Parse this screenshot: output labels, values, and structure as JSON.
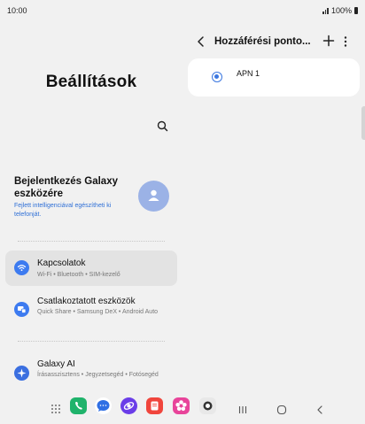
{
  "status_bar": {
    "time": "10:00",
    "battery": "100%"
  },
  "left_pane": {
    "title": "Beállítások",
    "account": {
      "title": "Bejelentkezés Galaxy eszközére",
      "subtitle": "Fejlett intelligenciával egészítheti ki telefonját."
    },
    "items": [
      {
        "title": "Kapcsolatok",
        "subtitle": "Wi-Fi  •  Bluetooth  •  SIM-kezelő",
        "icon": "wifi-icon",
        "color": "#3d7bf0"
      },
      {
        "title": "Csatlakoztatott eszközök",
        "subtitle": "Quick Share  •  Samsung DeX  •  Android Auto",
        "icon": "connected-devices-icon",
        "color": "#3d7bf0"
      },
      {
        "title": "Galaxy AI",
        "subtitle": "Írásasszisztens  •  Jegyzetsegéd  •  Fotósegéd",
        "icon": "galaxy-ai-icon",
        "color": "#3b6fe0"
      }
    ]
  },
  "right_pane": {
    "title": "Hozzáférési ponto...",
    "apn_items": [
      {
        "label": "APN 1",
        "selected": true
      }
    ]
  },
  "dock": {
    "apps": [
      {
        "name": "phone-app",
        "color": "#1fb36b"
      },
      {
        "name": "messages-app",
        "color": "#2f6fe4"
      },
      {
        "name": "internet-app",
        "color": "#6a3de8"
      },
      {
        "name": "notes-app",
        "color": "#f0453c"
      },
      {
        "name": "gallery-app",
        "color": "#e8449a"
      },
      {
        "name": "camera-app",
        "color": "#444444"
      }
    ]
  }
}
